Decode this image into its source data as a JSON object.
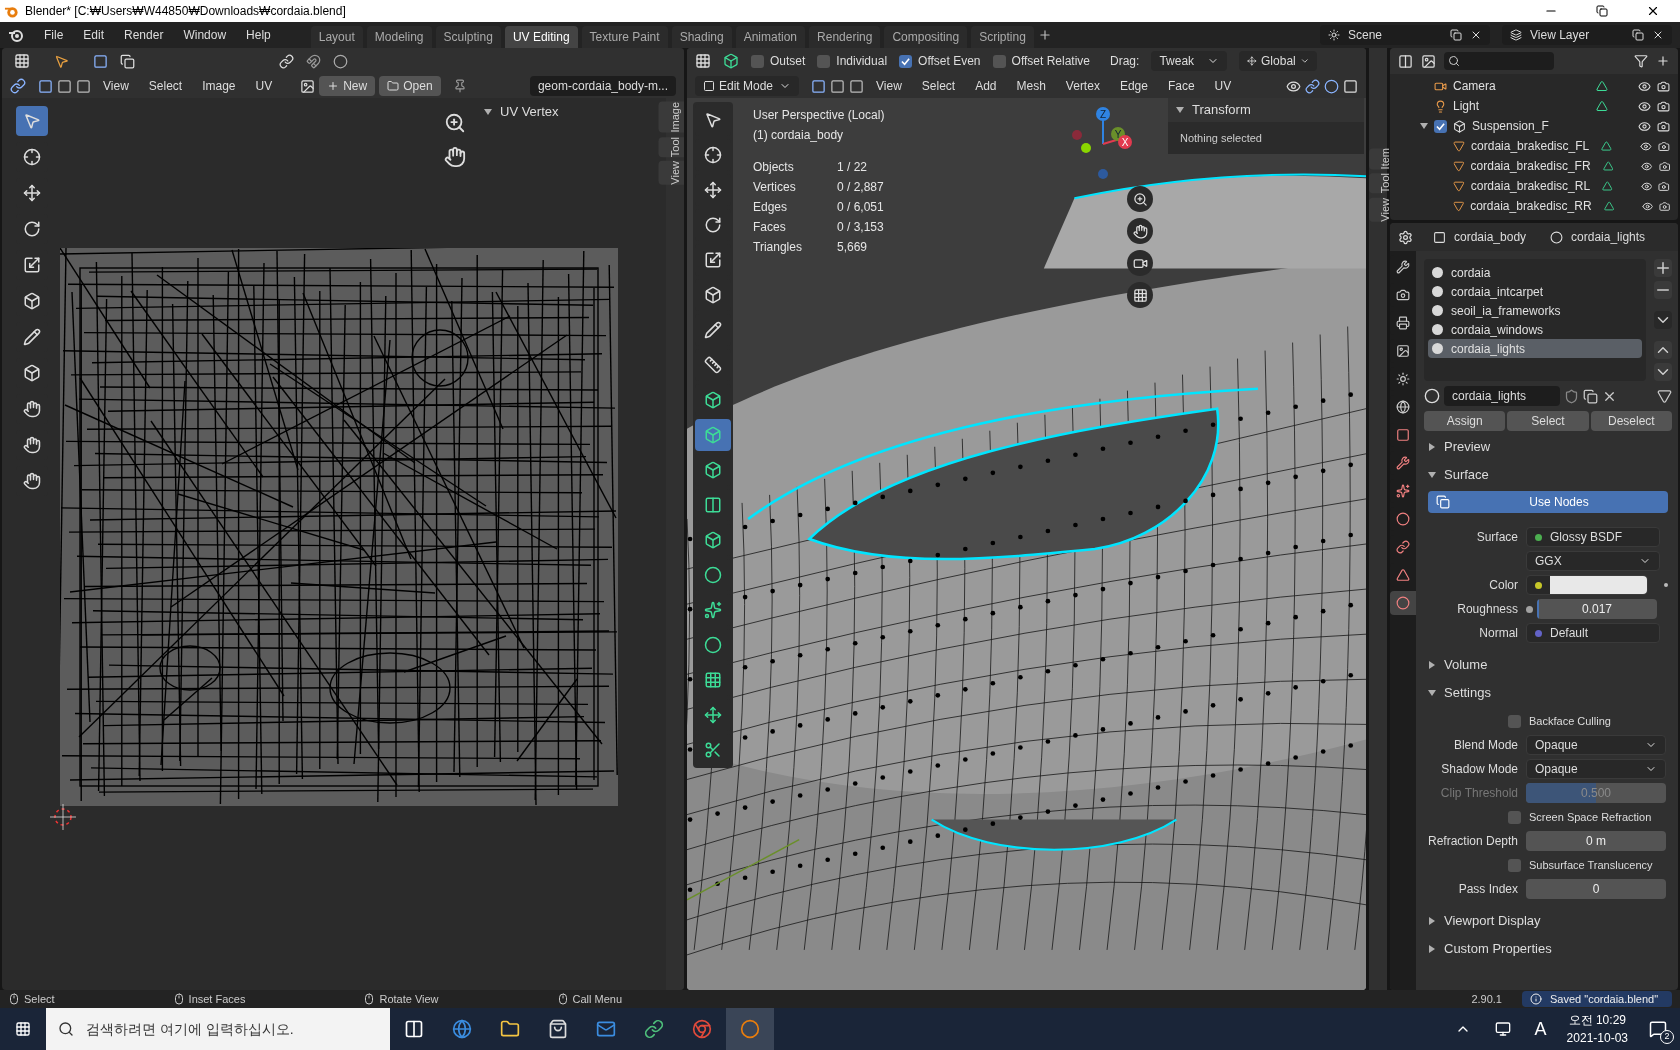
{
  "window": {
    "title": "Blender* [C:₩Users₩W44850₩Downloads₩cordaia.blend]"
  },
  "menu": [
    "File",
    "Edit",
    "Render",
    "Window",
    "Help"
  ],
  "workspaces": [
    {
      "label": "Layout",
      "selected": false
    },
    {
      "label": "Modeling",
      "selected": false
    },
    {
      "label": "Sculpting",
      "selected": false
    },
    {
      "label": "UV Editing",
      "selected": true
    },
    {
      "label": "Texture Paint",
      "selected": false
    },
    {
      "label": "Shading",
      "selected": false
    },
    {
      "label": "Animation",
      "selected": false
    },
    {
      "label": "Rendering",
      "selected": false
    },
    {
      "label": "Compositing",
      "selected": false
    },
    {
      "label": "Scripting",
      "selected": false
    }
  ],
  "scene": "Scene",
  "view_layer": "View Layer",
  "uv_editor": {
    "menus": [
      "View",
      "Select",
      "Image",
      "UV"
    ],
    "new_button": "New",
    "open_button": "Open",
    "image_name": "geom-cordaia_body-m...",
    "panel_title": "UV Vertex",
    "side_tabs": [
      "Image",
      "Tool",
      "View"
    ],
    "tools": [
      {
        "selected": true
      },
      {
        "selected": false
      },
      {
        "selected": false
      },
      {
        "selected": false
      },
      {
        "selected": false
      },
      {
        "selected": false
      },
      {
        "selected": false
      },
      {
        "selected": false
      },
      {
        "selected": false
      },
      {
        "selected": false
      },
      {
        "selected": false
      }
    ]
  },
  "viewport": {
    "options": [
      {
        "label": "Outset",
        "checked": false
      },
      {
        "label": "Individual",
        "checked": false
      },
      {
        "label": "Offset Even",
        "checked": true
      },
      {
        "label": "Offset Relative",
        "checked": false
      }
    ],
    "drag_label": "Drag:",
    "drag_value": "Tweak",
    "orientation": "Global",
    "mode": "Edit Mode",
    "menus": [
      "View",
      "Select",
      "Add",
      "Mesh",
      "Vertex",
      "Edge",
      "Face",
      "UV"
    ],
    "perspective": "User Perspective (Local)",
    "object": "(1) cordaia_body",
    "stats": [
      {
        "label": "Objects",
        "value": "1 / 22"
      },
      {
        "label": "Vertices",
        "value": "0 / 2,887"
      },
      {
        "label": "Edges",
        "value": "0 / 6,051"
      },
      {
        "label": "Faces",
        "value": "0 / 3,153"
      },
      {
        "label": "Triangles",
        "value": "5,669"
      }
    ],
    "gizmo": [
      "Z",
      "Y",
      "X"
    ],
    "transform_title": "Transform",
    "transform_text": "Nothing selected",
    "side_tabs": [
      "Item",
      "Tool",
      "View"
    ],
    "tools": [
      {
        "selected": false
      },
      {
        "selected": false
      },
      {
        "selected": false
      },
      {
        "selected": false
      },
      {
        "selected": false
      },
      {
        "selected": false
      },
      {
        "selected": false
      },
      {
        "selected": false
      },
      {
        "selected": false
      },
      {
        "selected": true
      },
      {
        "selected": false
      },
      {
        "selected": false
      },
      {
        "selected": false
      },
      {
        "selected": false
      },
      {
        "selected": false
      },
      {
        "selected": false
      },
      {
        "selected": false
      },
      {
        "selected": false
      },
      {
        "selected": false
      }
    ]
  },
  "outliner": {
    "items": [
      {
        "name": "Camera",
        "kind": "camera"
      },
      {
        "name": "Light",
        "kind": "light"
      },
      {
        "name": "Suspension_F",
        "kind": "collection",
        "checked": true,
        "expanded": true,
        "children": [
          {
            "name": "cordaia_brakedisc_FL",
            "kind": "mesh"
          },
          {
            "name": "cordaia_brakedisc_FR",
            "kind": "mesh"
          },
          {
            "name": "cordaia_brakedisc_RL",
            "kind": "mesh"
          },
          {
            "name": "cordaia_brakedisc_RR",
            "kind": "mesh"
          }
        ]
      }
    ]
  },
  "properties": {
    "tabs": [
      {
        "selected": false
      },
      {
        "selected": false
      },
      {
        "selected": false
      },
      {
        "selected": false
      },
      {
        "selected": false
      },
      {
        "selected": false
      },
      {
        "selected": false
      },
      {
        "selected": false
      },
      {
        "selected": false
      },
      {
        "selected": false
      },
      {
        "selected": false
      },
      {
        "selected": false
      },
      {
        "selected": true
      }
    ],
    "object": "cordaia_body",
    "material": "cordaia_lights",
    "slots": [
      {
        "name": "cordaia",
        "selected": false
      },
      {
        "name": "cordaia_intcarpet",
        "selected": false
      },
      {
        "name": "seoil_ia_frameworks",
        "selected": false
      },
      {
        "name": "cordaia_windows",
        "selected": false
      },
      {
        "name": "cordaia_lights",
        "selected": true
      }
    ],
    "material_field": "cordaia_lights",
    "actions": [
      "Assign",
      "Select",
      "Deselect"
    ],
    "panels": [
      {
        "title": "Preview",
        "expanded": false
      },
      {
        "title": "Surface",
        "expanded": true,
        "rows": [
          {
            "kind": "button",
            "label": "Use Nodes"
          },
          {
            "kind": "socket",
            "label": "Surface",
            "value": "Glossy BSDF",
            "color": "#4caf50"
          },
          {
            "kind": "dropdown",
            "value": "GGX"
          },
          {
            "kind": "color",
            "label": "Color",
            "color": "#c7c729"
          },
          {
            "kind": "slider",
            "label": "Roughness",
            "value": "0.017",
            "level": 0.017,
            "color": "#a1a1a1"
          },
          {
            "kind": "socket",
            "label": "Normal",
            "value": "Default",
            "color": "#6363c7"
          }
        ]
      },
      {
        "title": "Volume",
        "expanded": false
      },
      {
        "title": "Settings",
        "expanded": true,
        "rows": [
          {
            "kind": "checkbox",
            "label": "Backface Culling",
            "checked": false
          },
          {
            "kind": "dropdown",
            "label": "Blend Mode",
            "value": "Opaque"
          },
          {
            "kind": "dropdown",
            "label": "Shadow Mode",
            "value": "Opaque"
          },
          {
            "kind": "slider",
            "label": "Clip Threshold",
            "value": "0.500",
            "level": 0.5,
            "disabled": true
          },
          {
            "kind": "checkbox",
            "label": "Screen Space Refraction",
            "checked": false
          },
          {
            "kind": "number",
            "label": "Refraction Depth",
            "value": "0 m"
          },
          {
            "kind": "checkbox",
            "label": "Subsurface Translucency",
            "checked": false
          },
          {
            "kind": "number",
            "label": "Pass Index",
            "value": "0"
          }
        ]
      },
      {
        "title": "Viewport Display",
        "expanded": false
      },
      {
        "title": "Custom Properties",
        "expanded": false
      }
    ]
  },
  "status_bar": {
    "hints": [
      "Select",
      "Inset Faces",
      "Rotate View",
      "Call Menu"
    ],
    "version": "2.90.1",
    "message": "Saved \"cordaia.blend\""
  },
  "taskbar": {
    "search_placeholder": "검색하려면 여기에 입력하십시오.",
    "ime": "A",
    "time": "오전 10:29",
    "date": "2021-10-03",
    "notifications": "2"
  }
}
